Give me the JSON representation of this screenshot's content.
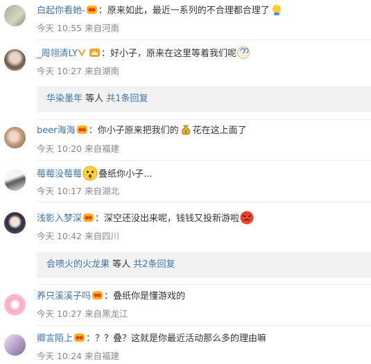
{
  "comments": [
    {
      "user": "白起你看她-",
      "colon": "：",
      "text_a": "原来如此，最近一系列的不合理都合理了",
      "text_b": "",
      "time": "今天 10:55",
      "location": "来自河南"
    },
    {
      "user": "_周翎清LY",
      "colon": "：",
      "text_a": "好小子，原来在这里等着我们呢",
      "text_b": "",
      "time": "今天 10:27",
      "location": "来自湖南"
    },
    {
      "user": "beer海海",
      "colon": "：",
      "text_a": "你小子原来把我们的",
      "text_b": "花在这上面了",
      "time": "今天 10:20",
      "location": "来自福建"
    },
    {
      "user": "莓莓没莓莓",
      "colon": "：",
      "text_a": "叠纸你小子...",
      "text_b": "",
      "time": "今天 10:17",
      "location": "来自湖北"
    },
    {
      "user": "浅影入梦深",
      "colon": "：",
      "text_a": "深空还没出来呢，钱钱又投新游啦",
      "text_b": "",
      "time": "今天 10:42",
      "location": "来自四川"
    },
    {
      "user": "养只溪溪子吗",
      "colon": "：",
      "text_a": "叠纸你是懂游戏的",
      "text_b": "",
      "time": "今天 10:27",
      "location": "来自黑龙江"
    },
    {
      "user": "卿言陌上",
      "colon": "：",
      "text_a": "？？叠？这就是你最近活动那么多的理由嘛",
      "text_b": "",
      "time": "今天 10:24",
      "location": "来自福建"
    }
  ],
  "replies": [
    {
      "user": "华染墨年",
      "middle": " 等人 ",
      "count": "共1条回复"
    },
    {
      "user": "会喷火的火龙果",
      "middle": " 等人 ",
      "count": "共2条回复"
    }
  ],
  "colors": {
    "link": "#3e74ab",
    "meta": "#888888",
    "reply_bg": "#f2f2f2"
  }
}
